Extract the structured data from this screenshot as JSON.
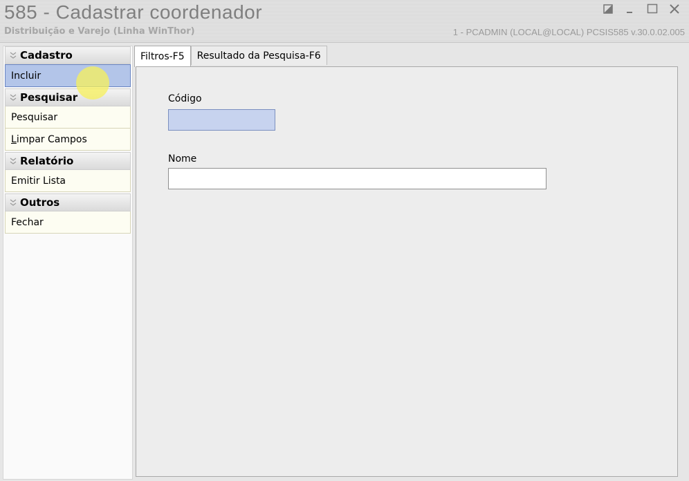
{
  "window": {
    "title": "585 - Cadastrar coordenador",
    "subtitle": "Distribuição e Varejo (Linha WinThor)",
    "status": "1 - PCADMIN (LOCAL@LOCAL)   PCSIS585  v.30.0.02.005",
    "controls": [
      "restore-icon",
      "minimize-icon",
      "maximize-icon",
      "close-icon"
    ]
  },
  "sidebar": {
    "groups": [
      {
        "title": "Cadastro",
        "items": [
          {
            "label": "Incluir"
          }
        ]
      },
      {
        "title": "Pesquisar",
        "items": [
          {
            "label": "Pesquisar"
          },
          {
            "label_first": "L",
            "label_rest": "impar Campos"
          }
        ]
      },
      {
        "title": "Relatório",
        "items": [
          {
            "label": "Emitir Lista"
          }
        ]
      },
      {
        "title": "Outros",
        "items": [
          {
            "label": "Fechar"
          }
        ]
      }
    ]
  },
  "tabs": [
    {
      "label": "Filtros-F5",
      "active": true
    },
    {
      "label": "Resultado da Pesquisa-F6",
      "active": false
    }
  ],
  "form": {
    "codigo_label": "Código",
    "codigo_value": "",
    "nome_label": "Nome",
    "nome_value": ""
  },
  "colors": {
    "active_item": "#b3c5e9",
    "highlight_field": "#c7d3ef",
    "cursor_highlight": "#f7f05a"
  }
}
